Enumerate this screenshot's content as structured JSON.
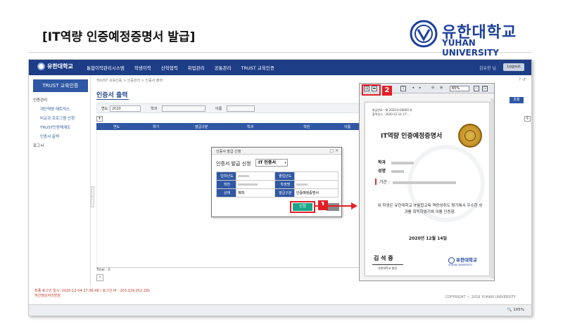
{
  "title": "[IT역량 인증예정증명서 발급]",
  "brand": {
    "name": "유한대학교",
    "sub": "YUHAN UNIVERSITY",
    "accent": "#1d3f9a"
  },
  "nav": {
    "logo": "유한대학교",
    "menu": [
      "통합이력관리시스템",
      "학생이력",
      "산학협력",
      "취업관리",
      "공통관리",
      "TRUST 교육인증"
    ],
    "user": "김유한 님",
    "logout": "Logout",
    "bar_color": "#1e3d87"
  },
  "sidebar": {
    "heading": "TRUST 교육인증",
    "items": [
      {
        "label": "인증관리",
        "sub": false
      },
      {
        "label": "개인역량 매트릭스",
        "sub": true
      },
      {
        "label": "비교과 프로그램 신청",
        "sub": true
      },
      {
        "label": "TRUST인증체계도",
        "sub": true
      },
      {
        "label": "인증서 출력",
        "sub": true
      },
      {
        "label": "로그서",
        "sub": false
      }
    ]
  },
  "content": {
    "breadcrumb": "TRUST 교육인증 > 인증관리 > 인증서 출력",
    "help": "? ↺",
    "title": "인증서 출력",
    "filter": {
      "year_label": "연도",
      "year_value": "2020",
      "dept_label": "학과",
      "name_label": "이름"
    },
    "table_headers": [
      "연도",
      "학기",
      "발급구분",
      "학과",
      "학번",
      "이름"
    ],
    "total": "Total : 0",
    "right_button": "조회"
  },
  "dialog": {
    "title": "인증서 발급 신청",
    "close": "□ ✕",
    "apply_label": "인증서 발급 신청",
    "select_value": "IT 인증서",
    "rows": [
      [
        {
          "h": "입학년도"
        },
        {
          "v": ""
        },
        {
          "h": "졸업년도"
        },
        {
          "v": ""
        }
      ],
      [
        {
          "h": "학번"
        },
        {
          "v": ""
        },
        {
          "h": "학생명"
        },
        {
          "v": ""
        }
      ],
      [
        {
          "h": "상태"
        },
        {
          "v": "재학"
        },
        {
          "h": "발급구분"
        },
        {
          "v": "인증예정증명서"
        }
      ]
    ],
    "submit": "신청"
  },
  "annotations": {
    "badge1": "1",
    "badge2": "2",
    "color": "#e21f26"
  },
  "viewer": {
    "zoom": "65%",
    "ref_line1": "발급번호 : 제 2020-0-00000 호",
    "ref_line2": "출력일시 : 2020-12-14 17:…",
    "cert_title": "IT역량 인증예정증명서",
    "field_dept": "학과",
    "field_name": "성명",
    "field_period": "기간 :",
    "body": "위 학생은 유한대학교 IT융합교육 역량성취도 평가에서 우수한 성과를 획득하였기에 이를 인증함.",
    "date": "2020년 12월 14일",
    "signature": "김 석 중",
    "signer_title": "유한대학교 총장",
    "logo": "유한대학교",
    "logo_sub": "YUHAN UNIVERSITY"
  },
  "footer": {
    "last_login": "최종 로그인 일시: 2020-12-04 17:36:48 / 로그인 IP : 203.229.252.181",
    "privacy": "개인정보처리방침",
    "copyright": "COPYRIGHT ⓒ 2016 YUHAN UNIVERSITY",
    "zoom": "🔍 105%"
  }
}
